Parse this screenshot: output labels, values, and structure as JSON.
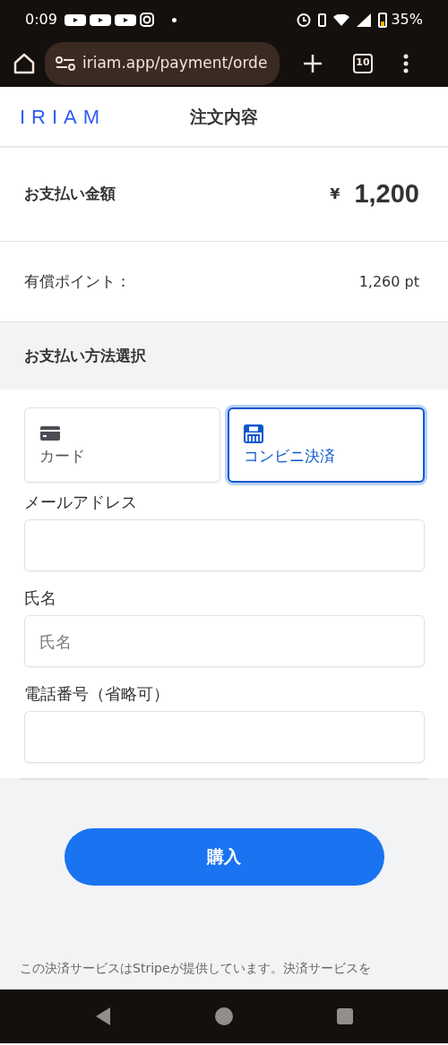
{
  "status_bar": {
    "time": "0:09",
    "battery": "35%"
  },
  "browser": {
    "url": "iriam.app/payment/orde",
    "tab_count": "10"
  },
  "header": {
    "logo": "IRIAM",
    "title": "注文内容"
  },
  "summary": {
    "amount_label": "お支払い金額",
    "currency": "¥",
    "amount": "1,200",
    "points_label": "有償ポイント：",
    "points": "1,260 pt"
  },
  "payment_method": {
    "heading": "お支払い方法選択",
    "tabs": [
      {
        "kind": "card",
        "label": "カード",
        "selected": false
      },
      {
        "kind": "konbini",
        "label": "コンビニ決済",
        "selected": true
      }
    ]
  },
  "fields": [
    {
      "label": "メールアドレス"
    },
    {
      "label": "氏名",
      "placeholder": "氏名"
    },
    {
      "label": "電話番号（省略可）"
    }
  ],
  "purchase_button": "購入",
  "footer_text": "この決済サービスはStripeが提供しています。決済サービスを"
}
